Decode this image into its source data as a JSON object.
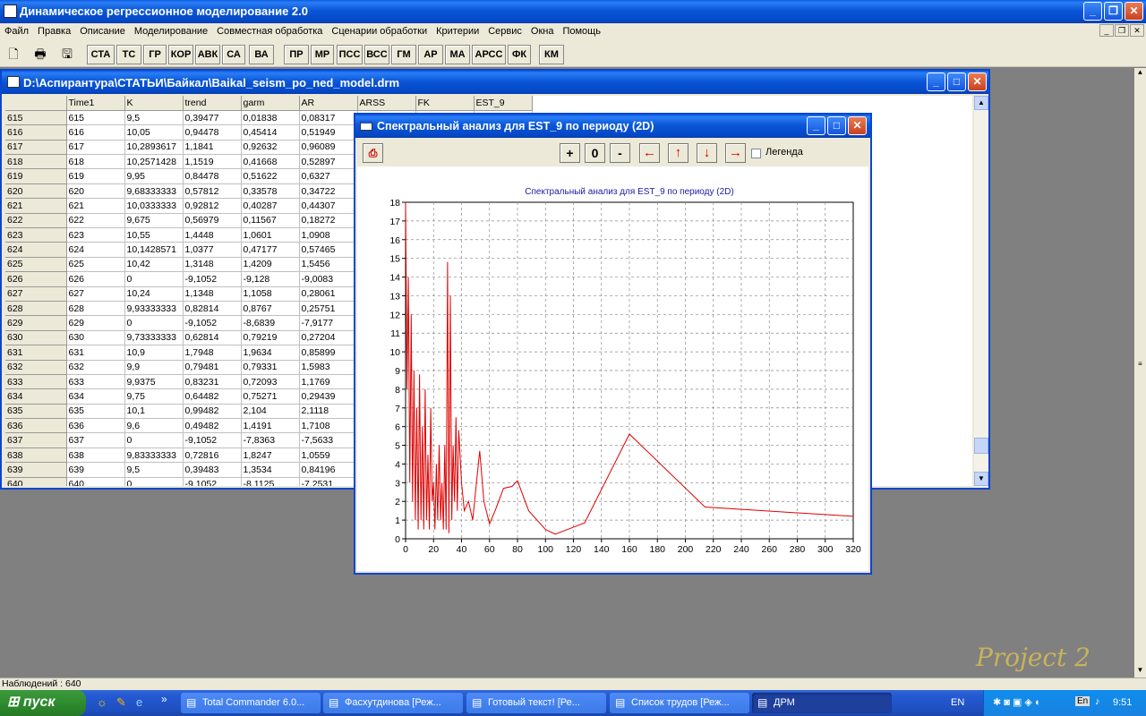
{
  "app": {
    "title": "Динамическое регрессионное моделирование 2.0",
    "window_controls": [
      "_",
      "❐",
      "✕"
    ]
  },
  "menu": [
    "Файл",
    "Правка",
    "Описание",
    "Моделирование",
    "Совместная обработка",
    "Сценарии обработки",
    "Критерии",
    "Сервис",
    "Окна",
    "Помощь"
  ],
  "toolbar": {
    "icons": [
      "new-icon",
      "print-icon",
      "save-icon"
    ],
    "buttons": [
      "СТА",
      "ТС",
      "ГР",
      "КОР",
      "АВК",
      "СА",
      "ВА",
      "ПР",
      "МР",
      "ПСС",
      "ВСС",
      "ГМ",
      "АР",
      "МА",
      "АРСС",
      "ФК",
      "КМ"
    ]
  },
  "data_window": {
    "title": "D:\\Аспирантура\\СТАТЬИ\\Байкал\\Baikal_seism_po_ned_model.drm",
    "columns": [
      "",
      "Time1",
      "K",
      "trend",
      "garm",
      "AR",
      "ARSS",
      "FK",
      "EST_9"
    ],
    "rows": [
      [
        "615",
        "615",
        "9,5",
        "0,39477",
        "0,01838",
        "0,08317"
      ],
      [
        "616",
        "616",
        "10,05",
        "0,94478",
        "0,45414",
        "0,51949"
      ],
      [
        "617",
        "617",
        "10,2893617",
        "1,1841",
        "0,92632",
        "0,96089"
      ],
      [
        "618",
        "618",
        "10,2571428",
        "1,1519",
        "0,41668",
        "0,52897"
      ],
      [
        "619",
        "619",
        "9,95",
        "0,84478",
        "0,51622",
        "0,6327"
      ],
      [
        "620",
        "620",
        "9,68333333",
        "0,57812",
        "0,33578",
        "0,34722"
      ],
      [
        "621",
        "621",
        "10,0333333",
        "0,92812",
        "0,40287",
        "0,44307"
      ],
      [
        "622",
        "622",
        "9,675",
        "0,56979",
        "0,11567",
        "0,18272"
      ],
      [
        "623",
        "623",
        "10,55",
        "1,4448",
        "1,0601",
        "1,0908"
      ],
      [
        "624",
        "624",
        "10,1428571",
        "1,0377",
        "0,47177",
        "0,57465"
      ],
      [
        "625",
        "625",
        "10,42",
        "1,3148",
        "1,4209",
        "1,5456"
      ],
      [
        "626",
        "626",
        "0",
        "-9,1052",
        "-9,128",
        "-9,0083"
      ],
      [
        "627",
        "627",
        "10,24",
        "1,1348",
        "1,1058",
        "0,28061"
      ],
      [
        "628",
        "628",
        "9,93333333",
        "0,82814",
        "0,8767",
        "0,25751"
      ],
      [
        "629",
        "629",
        "0",
        "-9,1052",
        "-8,6839",
        "-7,9177"
      ],
      [
        "630",
        "630",
        "9,73333333",
        "0,62814",
        "0,79219",
        "0,27204"
      ],
      [
        "631",
        "631",
        "10,9",
        "1,7948",
        "1,9634",
        "0,85899"
      ],
      [
        "632",
        "632",
        "9,9",
        "0,79481",
        "0,79331",
        "1,5983"
      ],
      [
        "633",
        "633",
        "9,9375",
        "0,83231",
        "0,72093",
        "1,1769"
      ],
      [
        "634",
        "634",
        "9,75",
        "0,64482",
        "0,75271",
        "0,29439"
      ],
      [
        "635",
        "635",
        "10,1",
        "0,99482",
        "2,104",
        "2,1118"
      ],
      [
        "636",
        "636",
        "9,6",
        "0,49482",
        "1,4191",
        "1,7108"
      ],
      [
        "637",
        "637",
        "0",
        "-9,1052",
        "-7,8363",
        "-7,5633"
      ],
      [
        "638",
        "638",
        "9,83333333",
        "0,72816",
        "1,8247",
        "1,0559"
      ],
      [
        "639",
        "639",
        "9,5",
        "0,39483",
        "1,3534",
        "0,84196"
      ],
      [
        "640",
        "640",
        "0",
        "-9,1052",
        "-8,1125",
        "-7,2531"
      ]
    ]
  },
  "chart_window": {
    "title": "Спектральный анализ для EST_9 по периоду (2D)",
    "buttons": [
      "+",
      "0",
      "-",
      "←",
      "↑",
      "↓",
      "→"
    ],
    "legend_label": "Легенда",
    "legend_checked": false
  },
  "chart_data": {
    "type": "line",
    "title": "Спектральный анализ для EST_9 по периоду (2D)",
    "xlabel": "",
    "ylabel": "",
    "xlim": [
      0,
      320
    ],
    "ylim": [
      0,
      18
    ],
    "xticks": [
      0,
      20,
      40,
      60,
      80,
      100,
      120,
      140,
      160,
      180,
      200,
      220,
      240,
      260,
      280,
      300,
      320
    ],
    "yticks": [
      0,
      1,
      2,
      3,
      4,
      5,
      6,
      7,
      8,
      9,
      10,
      11,
      12,
      13,
      14,
      15,
      16,
      17,
      18
    ],
    "grid": true,
    "series": [
      {
        "color": "#e00000",
        "x": [
          0,
          1,
          2,
          3,
          4,
          5,
          6,
          7,
          8,
          9,
          10,
          11,
          12,
          13,
          14,
          15,
          16,
          17,
          18,
          19,
          20,
          21,
          22,
          23,
          24,
          25,
          26,
          27,
          28,
          29,
          30,
          31,
          32,
          33,
          34,
          35,
          36,
          37,
          38,
          40,
          42,
          45,
          48,
          50,
          53,
          56,
          60,
          64,
          70,
          76,
          80,
          88,
          100,
          107,
          128,
          160,
          214,
          320
        ],
        "y": [
          18,
          8,
          14,
          3,
          12,
          2,
          9,
          1,
          7,
          0.5,
          8.8,
          1,
          6,
          0.5,
          8,
          1,
          4.5,
          0.5,
          7,
          2,
          3,
          0.5,
          4,
          1,
          5,
          1,
          3,
          0.5,
          5,
          0.5,
          14.8,
          0.3,
          13,
          1,
          5,
          2,
          6.5,
          1.5,
          5.8,
          3,
          1.5,
          2,
          1,
          2.5,
          4.7,
          2,
          0.8,
          1.5,
          2.7,
          2.8,
          3.1,
          1.5,
          0.5,
          0.25,
          0.85,
          5.6,
          1.7,
          1.2
        ]
      }
    ]
  },
  "status": {
    "text": "Наблюдений : 640"
  },
  "logo": {
    "text": "Project 2"
  },
  "taskbar": {
    "start": "пуск",
    "tasks": [
      "Total Commander 6.0...",
      "Фасхутдинова [Реж...",
      "Готовый текст! [Ре...",
      "Список трудов [Реж...",
      "ДРМ"
    ],
    "active_task": 4,
    "lang": "EN",
    "tray_lang": "En",
    "clock": "9:51"
  }
}
